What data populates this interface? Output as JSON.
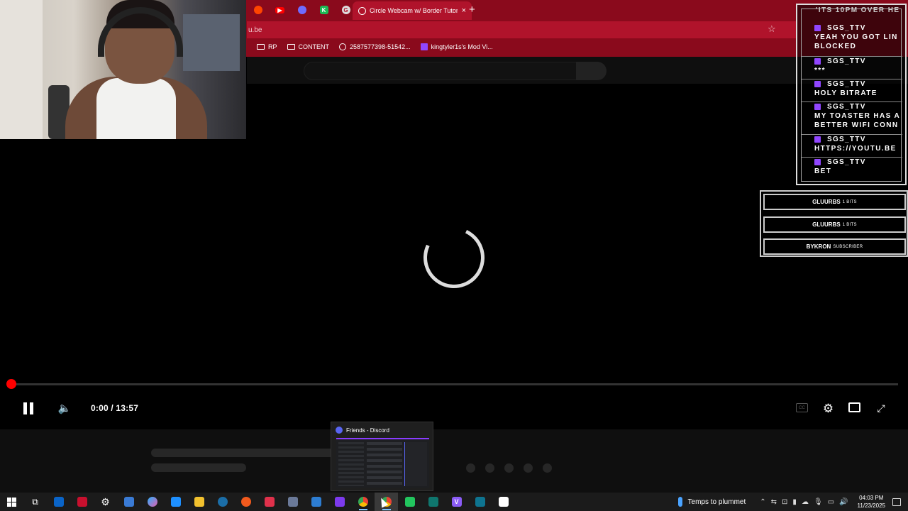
{
  "browser": {
    "active_tab_title": "Circle Webcam w/ Border Tutorial",
    "url_fragment": "u.be",
    "new_tab": "+",
    "close": "×",
    "bookmarks": [
      {
        "label": "RP",
        "icon": "folder-icon"
      },
      {
        "label": "CONTENT",
        "icon": "folder-icon"
      },
      {
        "label": "2587577398-51542...",
        "icon": "whatsapp-icon"
      },
      {
        "label": "kingtyler1s's Mod Vi...",
        "icon": "twitch-icon"
      }
    ]
  },
  "player": {
    "time": "0:00 / 13:57",
    "progress_fraction": 0,
    "cc_label": "CC"
  },
  "chat": {
    "top_fragment": "'ITS 10PM OVER HE",
    "messages": [
      {
        "user": "SGS_TTV",
        "text": [
          "YEAH YOU GOT LIN",
          "BLOCKED"
        ]
      },
      {
        "user": "SGS_TTV",
        "text": [
          "***"
        ]
      },
      {
        "user": "SGS_TTV",
        "text": [
          "HOLY BITRATE"
        ]
      },
      {
        "user": "SGS_TTV",
        "text": [
          "MY TOASTER HAS A",
          "BETTER WIFI CONN"
        ]
      },
      {
        "user": "SGS_TTV",
        "text": [
          "HTTPS://YOUTU.BE"
        ]
      },
      {
        "user": "SGS_TTV",
        "text": [
          "BET"
        ]
      }
    ]
  },
  "alerts": [
    {
      "name": "GLUURBS",
      "detail": "1 BITS"
    },
    {
      "name": "GLUURBS",
      "detail": "1 BITS"
    },
    {
      "name": "BYKRON",
      "detail": "SUBSCRIBER"
    }
  ],
  "preview": {
    "title": "Friends - Discord"
  },
  "taskbar": {
    "weather": "Temps to plummet",
    "time": "04:03 PM",
    "date": "11/23/2025"
  },
  "colors": {
    "chrome": "#8a0a1c",
    "accent_red": "#ff0000",
    "twitch": "#9146ff"
  }
}
